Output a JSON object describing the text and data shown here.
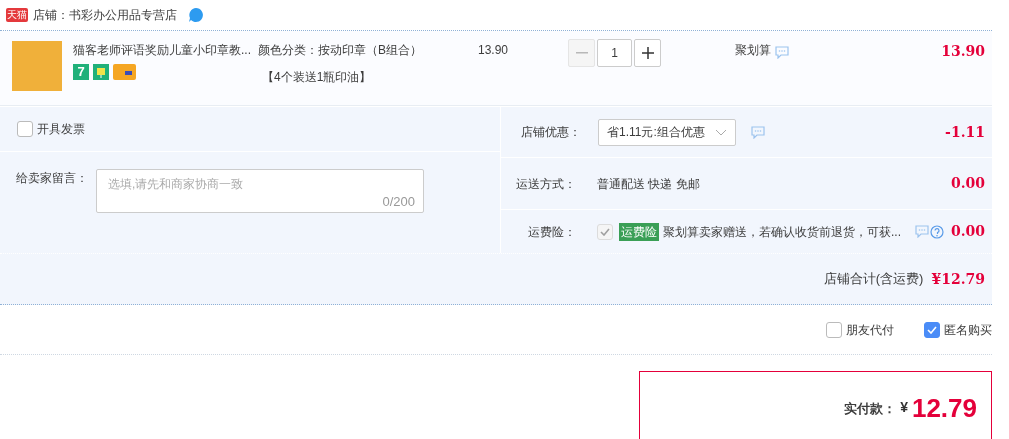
{
  "shop": {
    "badge": "天猫",
    "name": "店铺：书彩办公用品专营店"
  },
  "item": {
    "title": "猫客老师评语奖励儿童小印章教...",
    "spec": "颜色分类：按动印章（B组合）",
    "spec_note": "【4个装送1瓶印油】",
    "unit_price": "13.90",
    "quantity": "1",
    "minus_disabled": true,
    "promo": "聚划算",
    "subtotal": "13.90",
    "service_badge": "7"
  },
  "invoice": {
    "label": "开具发票",
    "checked": false
  },
  "message": {
    "label": "给卖家留言：",
    "placeholder": "选填,请先和商家协商一致",
    "counter": "0/200"
  },
  "discount": {
    "label": "店铺优惠：",
    "value": "省1.11元:组合优惠",
    "amount": "-1.11"
  },
  "shipping": {
    "label": "运送方式：",
    "value": "普通配送 快递 免邮",
    "amount": "0.00"
  },
  "insurance": {
    "label": "运费险：",
    "checked": true,
    "disabled": true,
    "tag": "运费险",
    "text": "聚划算卖家赠送，若确认收货前退货，可获...",
    "amount": "0.00"
  },
  "shop_total": {
    "label": "店铺合计(含运费)",
    "amount": "¥12.79"
  },
  "options": [
    {
      "label": "朋友代付",
      "checked": false
    },
    {
      "label": "匿名购买",
      "checked": true
    }
  ],
  "payment": {
    "label": "实付款：",
    "currency": "¥",
    "amount": "12.79"
  }
}
